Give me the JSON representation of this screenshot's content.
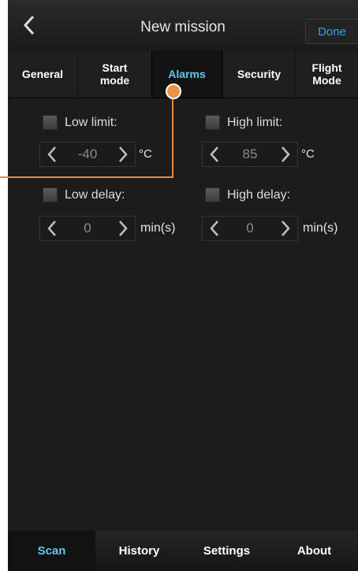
{
  "header": {
    "title": "New mission",
    "done_label": "Done",
    "back_icon": "chevron-left-icon"
  },
  "tabs": [
    {
      "label": "General",
      "active": false
    },
    {
      "label": "Start\nmode",
      "active": false
    },
    {
      "label": "Alarms",
      "active": true
    },
    {
      "label": "Security",
      "active": false
    },
    {
      "label": "Flight\nMode",
      "active": false
    }
  ],
  "alarms": {
    "low_limit": {
      "label": "Low limit:",
      "value": "-40",
      "unit": "°C",
      "checked": false
    },
    "high_limit": {
      "label": "High limit:",
      "value": "85",
      "unit": "°C",
      "checked": false
    },
    "low_delay": {
      "label": "Low delay:",
      "value": "0",
      "unit": "min(s)",
      "checked": false
    },
    "high_delay": {
      "label": "High delay:",
      "value": "0",
      "unit": "min(s)",
      "checked": false
    }
  },
  "bottom_nav": [
    {
      "label": "Scan",
      "active": true
    },
    {
      "label": "History",
      "active": false
    },
    {
      "label": "Settings",
      "active": false
    },
    {
      "label": "About",
      "active": false
    }
  ],
  "colors": {
    "accent": "#63c6f2",
    "done_text": "#2da6e0",
    "callout": "#f08f45",
    "background": "#1c1c1c"
  }
}
